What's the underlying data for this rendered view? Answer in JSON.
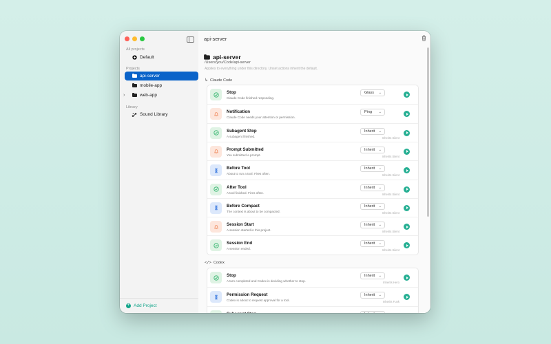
{
  "sidebar": {
    "all_projects_label": "All projects",
    "default_label": "Default",
    "projects_label": "Projects",
    "projects": [
      {
        "name": "api-server",
        "selected": true
      },
      {
        "name": "mobile-app",
        "selected": false
      },
      {
        "name": "web-app",
        "selected": false,
        "collapsible": true
      }
    ],
    "library_label": "Library",
    "sound_library_label": "Sound Library",
    "add_project_label": "Add Project"
  },
  "header": {
    "title": "api-server"
  },
  "project": {
    "name": "api-server",
    "path": "/Users/you/Code/api-server",
    "hint": "Applies to everything under this directory. Unset actions inherit the default."
  },
  "groups": [
    {
      "name": "Claude Code",
      "icon": "claude-arrow-icon",
      "rows": [
        {
          "title": "Stop",
          "desc": "Claude Code finished responding.",
          "value": "Glass",
          "inherit": "",
          "icon": "check-icon",
          "color": "green"
        },
        {
          "title": "Notification",
          "desc": "Claude Code needs your attention or permission.",
          "value": "Ping",
          "inherit": "",
          "icon": "bell-icon",
          "color": "orange"
        },
        {
          "title": "Subagent Stop",
          "desc": "A subagent finished.",
          "value": "Inherit",
          "inherit": "Inherits Silent",
          "icon": "check-icon",
          "color": "green"
        },
        {
          "title": "Prompt Submitted",
          "desc": "You submitted a prompt.",
          "value": "Inherit",
          "inherit": "Inherits Silent",
          "icon": "bell-icon",
          "color": "orange"
        },
        {
          "title": "Before Tool",
          "desc": "About to run a tool. Fires often.",
          "value": "Inherit",
          "inherit": "Inherits Silent",
          "icon": "hourglass-icon",
          "color": "blue"
        },
        {
          "title": "After Tool",
          "desc": "A tool finished. Fires often.",
          "value": "Inherit",
          "inherit": "Inherits Silent",
          "icon": "check-icon",
          "color": "green"
        },
        {
          "title": "Before Compact",
          "desc": "The context is about to be compacted.",
          "value": "Inherit",
          "inherit": "Inherits Silent",
          "icon": "hourglass-icon",
          "color": "blue"
        },
        {
          "title": "Session Start",
          "desc": "A session started in this project.",
          "value": "Inherit",
          "inherit": "Inherits Silent",
          "icon": "bell-icon",
          "color": "orange"
        },
        {
          "title": "Session End",
          "desc": "A session ended.",
          "value": "Inherit",
          "inherit": "Inherits Silent",
          "icon": "check-icon",
          "color": "green"
        }
      ]
    },
    {
      "name": "Codex",
      "icon": "code-icon",
      "rows": [
        {
          "title": "Stop",
          "desc": "A turn completed and Codex is deciding whether to stop.",
          "value": "Inherit",
          "inherit": "Inherits Hero",
          "icon": "check-icon",
          "color": "green"
        },
        {
          "title": "Permission Request",
          "desc": "Codex is about to request approval for a tool.",
          "value": "Inherit",
          "inherit": "Inherits Funk",
          "icon": "hourglass-icon",
          "color": "blue"
        },
        {
          "title": "Subagent Stop",
          "desc": "",
          "value": "Inherit",
          "inherit": "",
          "icon": "check-icon",
          "color": "green"
        }
      ]
    }
  ],
  "colors": {
    "accent": "#0a63c9",
    "teal": "#28b094",
    "green": "#2fb36b",
    "orange": "#f08a5d",
    "blue": "#3b7ae0"
  }
}
